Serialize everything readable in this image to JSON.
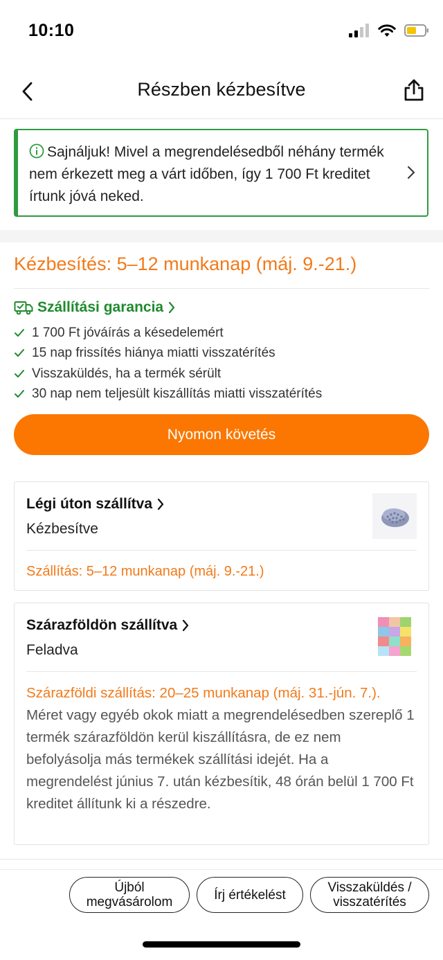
{
  "status_bar": {
    "time": "10:10"
  },
  "nav": {
    "title": "Részben kézbesítve"
  },
  "notice": {
    "text": "Sajnáljuk! Mivel a megrendelésedből néhány termék nem érkezett meg a várt időben, így 1 700 Ft kreditet írtunk jóvá neked."
  },
  "delivery": {
    "title": "Kézbesítés: 5–12 munkanap (máj. 9.-21.)"
  },
  "guarantee": {
    "title": "Szállítási garancia",
    "items": [
      "1 700 Ft jóváírás a késedelemért",
      "15 nap frissítés hiánya miatti visszatérítés",
      "Visszaküldés, ha a termék sérült",
      "30 nap nem teljesült kiszállítás miatti visszatérítés"
    ],
    "check_color": "#1f8a2d"
  },
  "track_button": {
    "label": "Nyomon követés"
  },
  "shipments": [
    {
      "title": "Légi úton szállítva",
      "status": "Kézbesítve",
      "eta": "Szállítás: 5–12 munkanap (máj. 9.-21.)"
    },
    {
      "title": "Szárazföldön szállítva",
      "status": "Feladva",
      "eta": "Szárazföldi szállítás: 20–25 munkanap (máj. 31.-jún. 7.).",
      "note": " Méret vagy egyéb okok miatt a megrendelésedben szereplő 1 termék szárazföldön kerül kiszállításra, de ez nem befolyásolja más termékek szállítási idejét. Ha a megrendelést június 7. után kézbesítik, 48 órán belül 1 700 Ft kreditet állítunk ki a részedre."
    }
  ],
  "actions": {
    "rebuy": "Újból megvásárolom",
    "review": "Írj értékelést",
    "return": "Visszaküldés / visszatérítés"
  },
  "colors": {
    "accent_orange": "#fb7701",
    "orange_text": "#f27a1a",
    "success_green": "#2e9b3f"
  },
  "icons": [
    "back-icon",
    "share-icon",
    "info-icon",
    "chevron-right-icon",
    "truck-check-icon",
    "check-icon"
  ]
}
